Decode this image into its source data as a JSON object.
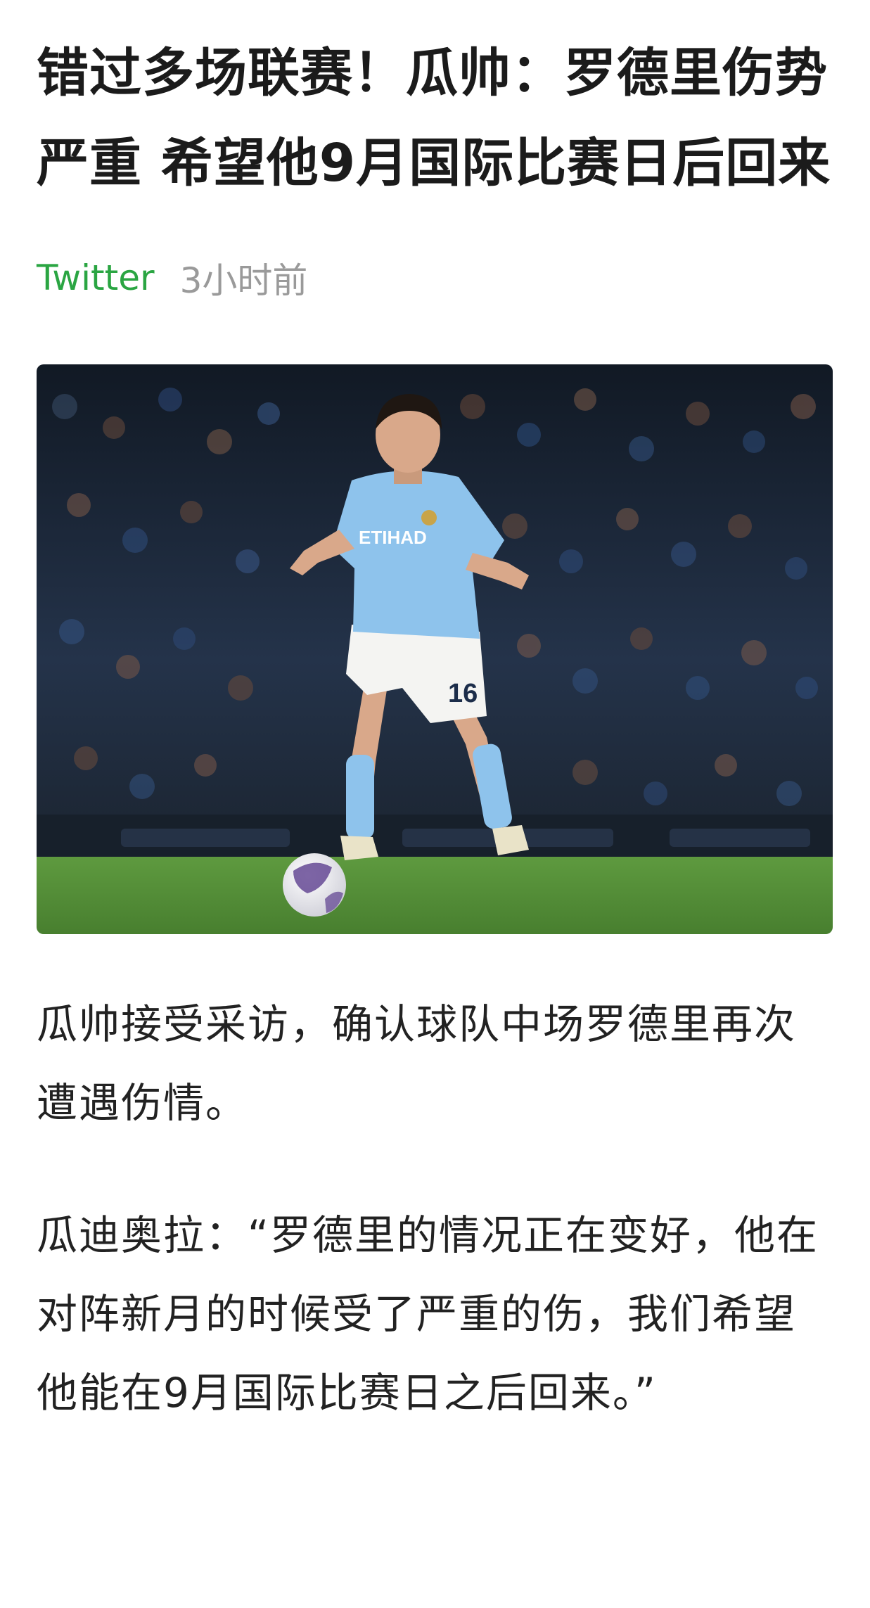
{
  "article": {
    "headline": "错过多场联赛！瓜帅：罗德里伤势严重 希望他9月国际比赛日后回来",
    "source": "Twitter",
    "time_ago": "3小时前",
    "photo": {
      "jersey_number": "16",
      "sponsor_text": "ETIHAD",
      "colors": {
        "kit": "#8ec3ec",
        "shorts": "#f4f4f2",
        "pitch": "#4f8a35",
        "crowd": "#1d2836"
      }
    },
    "paragraphs": [
      "瓜帅接受采访，确认球队中场罗德里再次遭遇伤情。",
      "瓜迪奥拉：“罗德里的情况正在变好，他在对阵新月的时候受了严重的伤，我们希望他能在9月国际比赛日之后回来。”"
    ]
  },
  "colors": {
    "source_link": "#2aa542",
    "timestamp": "#9a9a9a",
    "text": "#1b1b1b"
  }
}
